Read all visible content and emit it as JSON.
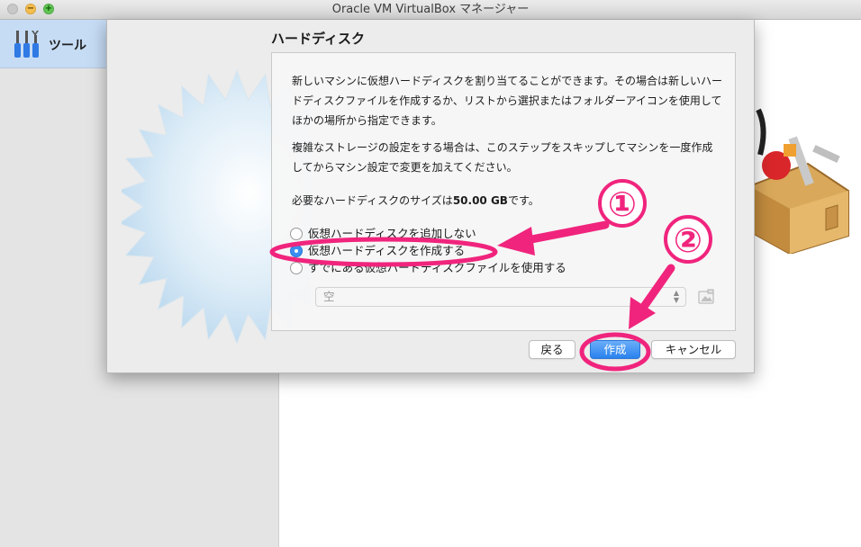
{
  "window": {
    "title": "Oracle VM VirtualBox マネージャー"
  },
  "sidebar": {
    "tools_label": "ツール"
  },
  "dialog": {
    "title": "ハードディスク",
    "paragraph1": "新しいマシンに仮想ハードディスクを割り当てることができます。その場合は新しいハードディスクファイルを作成するか、リストから選択またはフォルダーアイコンを使用してほかの場所から指定できます。",
    "paragraph2": "複雑なストレージの設定をする場合は、このステップをスキップしてマシンを一度作成してからマシン設定で変更を加えてください。",
    "size_prefix": "必要なハードディスクのサイズは",
    "size_value": "50.00 GB",
    "size_suffix": "です。",
    "options": [
      {
        "label": "仮想ハードディスクを追加しない",
        "selected": false
      },
      {
        "label": "仮想ハードディスクを作成する",
        "selected": true
      },
      {
        "label": "すでにある仮想ハードディスクファイルを使用する",
        "selected": false
      }
    ],
    "disk_select_value": "空",
    "buttons": {
      "back": "戻る",
      "create": "作成",
      "cancel": "キャンセル"
    }
  },
  "annotations": {
    "step1": "①",
    "step2": "②",
    "color": "#f0247d"
  }
}
